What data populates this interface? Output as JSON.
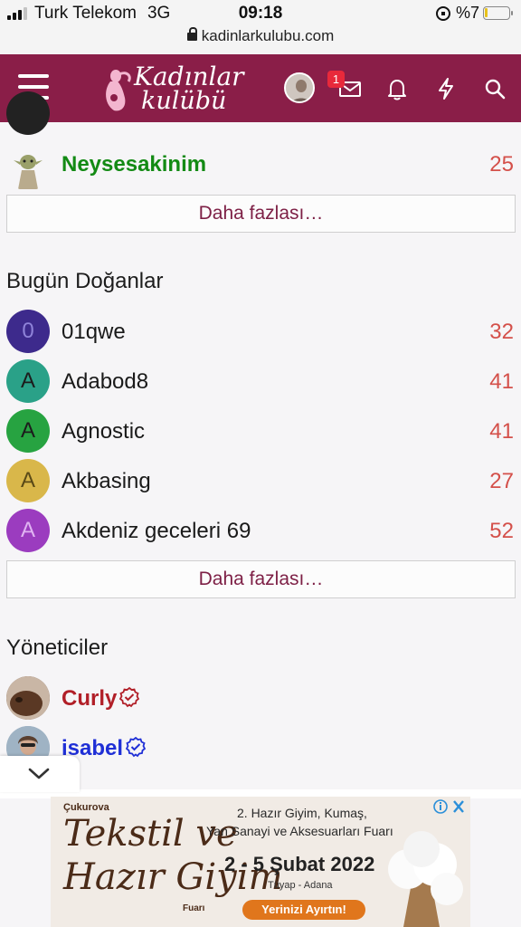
{
  "status_bar": {
    "carrier": "Turk Telekom",
    "network": "3G",
    "time": "09:18",
    "battery": "%7"
  },
  "browser": {
    "url": "kadinlarkulubu.com"
  },
  "header": {
    "logo_line1": "Kadınlar",
    "logo_line2": "kulübü",
    "message_badge": "1"
  },
  "online_users": {
    "last_user": {
      "name": "Neysesakinim",
      "count": "25",
      "color": "#138a14"
    },
    "more_label": "Daha fazlası…"
  },
  "birthdays": {
    "title": "Bugün Doğanlar",
    "users": [
      {
        "initial": "0",
        "name": "01qwe",
        "age": "32",
        "avatar_color": "#3d2a8c"
      },
      {
        "initial": "A",
        "name": "Adabod8",
        "age": "41",
        "avatar_color": "#2aa188"
      },
      {
        "initial": "A",
        "name": "Agnostic",
        "age": "41",
        "avatar_color": "#27a341"
      },
      {
        "initial": "A",
        "name": "Akbasing",
        "age": "27",
        "avatar_color": "#d9b74a"
      },
      {
        "initial": "A",
        "name": "Akdeniz geceleri 69",
        "age": "52",
        "avatar_color": "#9b3cbf"
      }
    ],
    "more_label": "Daha fazlası…"
  },
  "admins": {
    "title": "Yöneticiler",
    "users": [
      {
        "name": "Curly",
        "color": "#b11f28"
      },
      {
        "name": "isabel",
        "color": "#1f2fd6"
      }
    ]
  },
  "ad": {
    "brand": "Çukurova",
    "title_line1": "Tekstil ve",
    "title_line2": "Hazır Giyim",
    "title_suffix": "Fuarı",
    "headline_line1": "2. Hazır Giyim, Kumaş,",
    "headline_line2": "Yan Sanayi ve Aksesuarları Fuarı",
    "dates": "2 - 5 Şubat 2022",
    "venue": "Tüyap - Adana",
    "cta": "Yerinizi Ayırtın!"
  },
  "colors": {
    "brand": "#8a1e48",
    "count_red": "#d4504a",
    "more_text": "#7d1f45"
  }
}
